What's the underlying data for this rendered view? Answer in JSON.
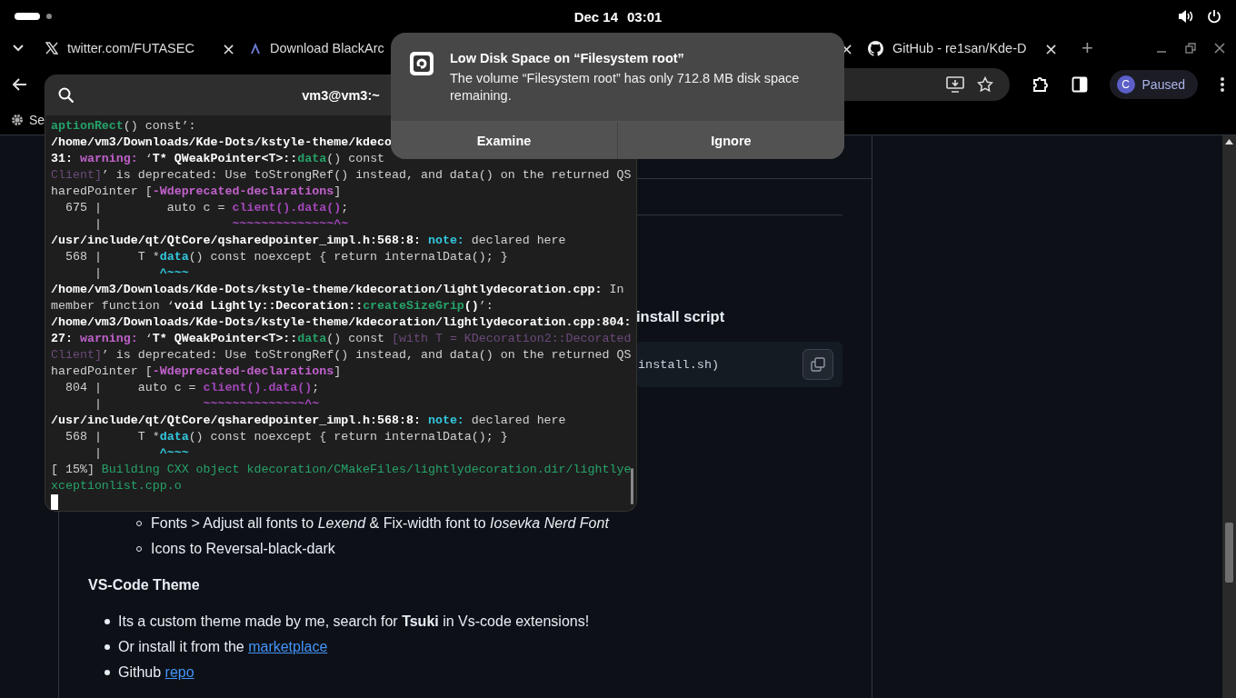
{
  "top_bar": {
    "date": "Dec 14",
    "time": "03:01"
  },
  "tabs": [
    {
      "kind": "x",
      "title": "twitter.com/FUTASEC",
      "close": "×"
    },
    {
      "kind": "arch",
      "title": "Download BlackArc",
      "close": "×"
    },
    {
      "kind": "github",
      "title": "GitHub - re1san/Kde-D",
      "close": "×"
    }
  ],
  "new_tab": "+",
  "profile": {
    "initial": "C",
    "status": "Paused"
  },
  "bookmarks": [
    "Se"
  ],
  "readme": {
    "heading": "install script",
    "code": "install.sh)",
    "sublist": [
      "Fonts > Adjust all fonts to *Lexend* & Fix-width font to *Iosevka Nerd Font*",
      "Icons to Reversal-black-dark"
    ],
    "section_title": "VS-Code Theme",
    "items": [
      {
        "text": "Its a custom theme made by me, search for **Tsuki** in Vs-code extensions!"
      },
      {
        "text": "Or install it from the ",
        "link": "marketplace"
      },
      {
        "text": "Github ",
        "link": "repo"
      }
    ]
  },
  "terminal": {
    "title": "vm3@vm3:~",
    "lines": [
      [
        {
          "kind": "func",
          "text": "aptionRect"
        },
        {
          "kind": "plain",
          "text": "() const’:"
        }
      ],
      [
        {
          "kind": "bold",
          "text": "/home/vm3/Downloads/Kde-Dots/kstyle-theme/kdeco"
        }
      ],
      [
        {
          "kind": "bold",
          "text": "31: "
        },
        {
          "kind": "warn",
          "text": "warning:"
        },
        {
          "kind": "plain",
          "text": " ‘"
        },
        {
          "kind": "bold",
          "text": "T* QWeakPointer<T>::"
        },
        {
          "kind": "func",
          "text": "data"
        },
        {
          "kind": "plain",
          "text": "() const"
        }
      ],
      [
        {
          "kind": "dim",
          "text": "Client]"
        },
        {
          "kind": "plain",
          "text": "’ is deprecated: Use toStrongRef() instead, and data() on the returned QS"
        }
      ],
      [
        {
          "kind": "plain",
          "text": "haredPointer ["
        },
        {
          "kind": "flag",
          "text": "-Wdeprecated-declarations"
        },
        {
          "kind": "plain",
          "text": "]"
        }
      ],
      [
        {
          "kind": "plain",
          "text": "  675 |         auto c = "
        },
        {
          "kind": "call",
          "text": "client().data()"
        },
        {
          "kind": "plain",
          "text": ";"
        }
      ],
      [
        {
          "kind": "plain",
          "text": "      |                  "
        },
        {
          "kind": "call",
          "text": "~~~~~~~~~~~~~~^~"
        }
      ],
      [
        {
          "kind": "bold",
          "text": "/usr/include/qt/QtCore/qsharedpointer_impl.h:568:8: "
        },
        {
          "kind": "note",
          "text": "note:"
        },
        {
          "kind": "plain",
          "text": " declared here"
        }
      ],
      [
        {
          "kind": "plain",
          "text": "  568 |     T *"
        },
        {
          "kind": "note",
          "text": "data"
        },
        {
          "kind": "plain",
          "text": "() const noexcept { return internalData(); }"
        }
      ],
      [
        {
          "kind": "plain",
          "text": "      |        "
        },
        {
          "kind": "note",
          "text": "^~~~"
        }
      ],
      [
        {
          "kind": "bold",
          "text": "/home/vm3/Downloads/Kde-Dots/kstyle-theme/kdecoration/lightlydecoration.cpp:"
        },
        {
          "kind": "plain",
          "text": " In"
        }
      ],
      [
        {
          "kind": "plain",
          "text": "member function ‘"
        },
        {
          "kind": "bold",
          "text": "void Lightly::Decoration::"
        },
        {
          "kind": "func",
          "text": "createSizeGrip"
        },
        {
          "kind": "bold",
          "text": "()"
        },
        {
          "kind": "plain",
          "text": "’:"
        }
      ],
      [
        {
          "kind": "bold",
          "text": "/home/vm3/Downloads/Kde-Dots/kstyle-theme/kdecoration/lightlydecoration.cpp:804:"
        }
      ],
      [
        {
          "kind": "bold",
          "text": "27: "
        },
        {
          "kind": "warn",
          "text": "warning:"
        },
        {
          "kind": "plain",
          "text": " ‘"
        },
        {
          "kind": "bold",
          "text": "T* QWeakPointer<T>::"
        },
        {
          "kind": "func",
          "text": "data"
        },
        {
          "kind": "plain",
          "text": "() const "
        },
        {
          "kind": "dim",
          "text": "[with T = KDecoration2::Decorated"
        }
      ],
      [
        {
          "kind": "dim",
          "text": "Client]"
        },
        {
          "kind": "plain",
          "text": "’ is deprecated: Use toStrongRef() instead, and data() on the returned QS"
        }
      ],
      [
        {
          "kind": "plain",
          "text": "haredPointer ["
        },
        {
          "kind": "flag",
          "text": "-Wdeprecated-declarations"
        },
        {
          "kind": "plain",
          "text": "]"
        }
      ],
      [
        {
          "kind": "plain",
          "text": "  804 |     auto c = "
        },
        {
          "kind": "call",
          "text": "client().data()"
        },
        {
          "kind": "plain",
          "text": ";"
        }
      ],
      [
        {
          "kind": "plain",
          "text": "      |              "
        },
        {
          "kind": "call",
          "text": "~~~~~~~~~~~~~~^~"
        }
      ],
      [
        {
          "kind": "bold",
          "text": "/usr/include/qt/QtCore/qsharedpointer_impl.h:568:8: "
        },
        {
          "kind": "note",
          "text": "note:"
        },
        {
          "kind": "plain",
          "text": " declared here"
        }
      ],
      [
        {
          "kind": "plain",
          "text": "  568 |     T *"
        },
        {
          "kind": "note",
          "text": "data"
        },
        {
          "kind": "plain",
          "text": "() const noexcept { return internalData(); }"
        }
      ],
      [
        {
          "kind": "plain",
          "text": "      |        "
        },
        {
          "kind": "note",
          "text": "^~~~"
        }
      ],
      [
        {
          "kind": "plain",
          "text": "[ 15%] "
        },
        {
          "kind": "green",
          "text": "Building CXX object kdecoration/CMakeFiles/lightlydecoration.dir/lightlye"
        }
      ],
      [
        {
          "kind": "green",
          "text": "xceptionlist.cpp.o"
        }
      ]
    ]
  },
  "notification": {
    "title": "Low Disk Space on “Filesystem root”",
    "body": "The volume “Filesystem root” has only 712.8 MB disk space remaining.",
    "actions": [
      "Examine",
      "Ignore"
    ]
  }
}
